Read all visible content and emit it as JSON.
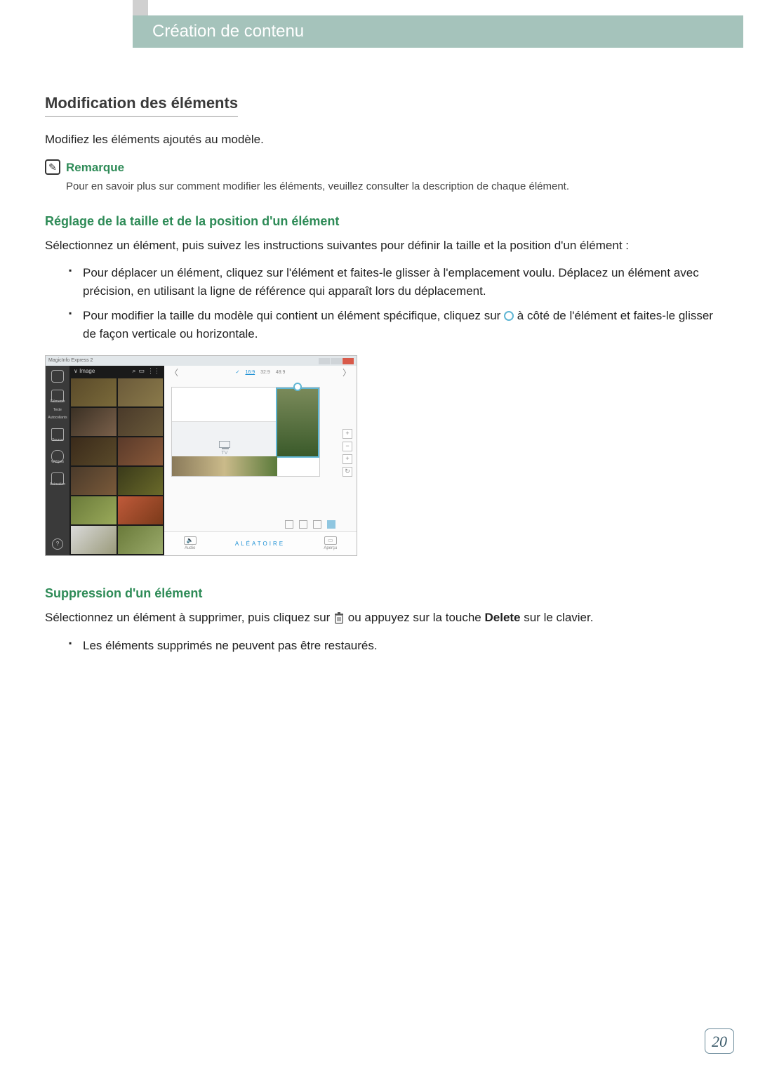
{
  "header": {
    "title": "Création de contenu"
  },
  "section": {
    "title": "Modification des éléments",
    "intro": "Modifiez les éléments ajoutés au modèle.",
    "note_label": "Remarque",
    "note_body": "Pour en savoir plus sur comment modifier les éléments, veuillez consulter la description de chaque élément."
  },
  "resize": {
    "heading": "Réglage de la taille et de la position d'un élément",
    "intro": "Sélectionnez un élément, puis suivez les instructions suivantes pour définir la taille et la position d'un élément :",
    "bullet1": "Pour déplacer un élément, cliquez sur l'élément et faites-le glisser à l'emplacement voulu. Déplacez un élément avec précision, en utilisant la ligne de référence qui apparaît lors du déplacement.",
    "bullet2a": "Pour modifier la taille du modèle qui contient un élément spécifique, cliquez sur ",
    "bullet2b": " à côté de l'élément et faites-le glisser de façon verticale ou horizontale."
  },
  "app": {
    "title": "MagicInfo Express 2",
    "sidebar": {
      "elements": "Éléments",
      "texte": "Texte",
      "autoc": "Autocollants",
      "source": "Source",
      "widgets": "Widgets",
      "anim": "Animation",
      "help": "?"
    },
    "gallery": {
      "dropdown": "Image"
    },
    "aspects": {
      "sel": "16:9",
      "a2": "32:9",
      "a3": "48:9",
      "check": "✓"
    },
    "tv_label": "TV",
    "controls": {
      "plus": "+",
      "minus": "−",
      "rot": "↻"
    },
    "bottom": {
      "audio": "Audio",
      "random": "ALÉATOIRE",
      "apercu": "Aperçu"
    }
  },
  "delete": {
    "heading": "Suppression d'un élément",
    "text_a": "Sélectionnez un élément à supprimer, puis cliquez sur ",
    "text_b": " ou appuyez sur la touche ",
    "text_bold": "Delete",
    "text_c": " sur le clavier.",
    "bullet": "Les éléments supprimés ne peuvent pas être restaurés."
  },
  "page_number": "20"
}
